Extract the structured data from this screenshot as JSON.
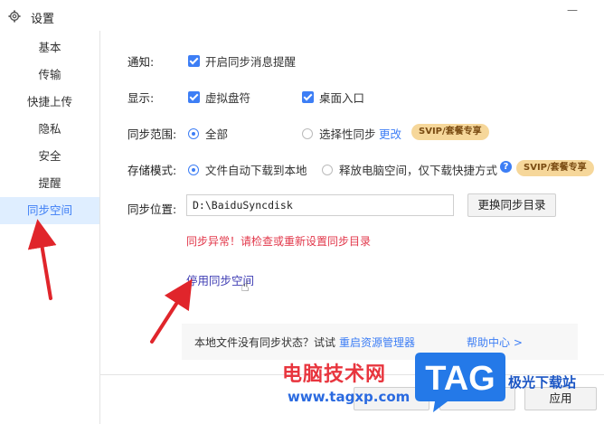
{
  "window": {
    "title": "设置",
    "icon": "gear-icon",
    "close_glyph": "—"
  },
  "sidebar": {
    "items": [
      {
        "label": "基本",
        "active": false
      },
      {
        "label": "传输",
        "active": false
      },
      {
        "label": "快捷上传",
        "active": false
      },
      {
        "label": "隐私",
        "active": false
      },
      {
        "label": "安全",
        "active": false
      },
      {
        "label": "提醒",
        "active": false
      },
      {
        "label": "同步空间",
        "active": true
      }
    ]
  },
  "settings": {
    "notify": {
      "label": "通知:",
      "option": "开启同步消息提醒",
      "checked": true
    },
    "display": {
      "label": "显示:",
      "options": [
        {
          "label": "虚拟盘符",
          "checked": true
        },
        {
          "label": "桌面入口",
          "checked": true
        }
      ]
    },
    "sync_scope": {
      "label": "同步范围:",
      "options": [
        {
          "label": "全部",
          "selected": true
        },
        {
          "label": "选择性同步",
          "selected": false
        }
      ],
      "change_link": "更改",
      "badge": "SVIP/套餐专享"
    },
    "storage_mode": {
      "label": "存储模式:",
      "options": [
        {
          "label": "文件自动下载到本地",
          "selected": true
        },
        {
          "label": "释放电脑空间，仅下载快捷方式",
          "selected": false
        }
      ],
      "help_glyph": "?",
      "badge": "SVIP/套餐专享"
    },
    "sync_location": {
      "label": "同步位置:",
      "path": "D:\\BaiduSyncdisk",
      "change_button": "更换同步目录"
    },
    "error_text": "同步异常！请检查或重新设置同步目录",
    "disable_link": "停用同步空间"
  },
  "tip": {
    "text": "本地文件没有同步状态？试试",
    "link": "重启资源管理器",
    "help": "帮助中心 >"
  },
  "footer": {
    "apply_button": "应用"
  },
  "watermark": {
    "cn": "电脑技术网",
    "url": "www.tagxp.com",
    "tag": "TAG",
    "site": "极光下载站"
  },
  "colors": {
    "accent": "#3d7ef5",
    "error": "#e2374a",
    "badge_bg": "#f6d79a",
    "annotation_arrow": "#e0252b"
  }
}
